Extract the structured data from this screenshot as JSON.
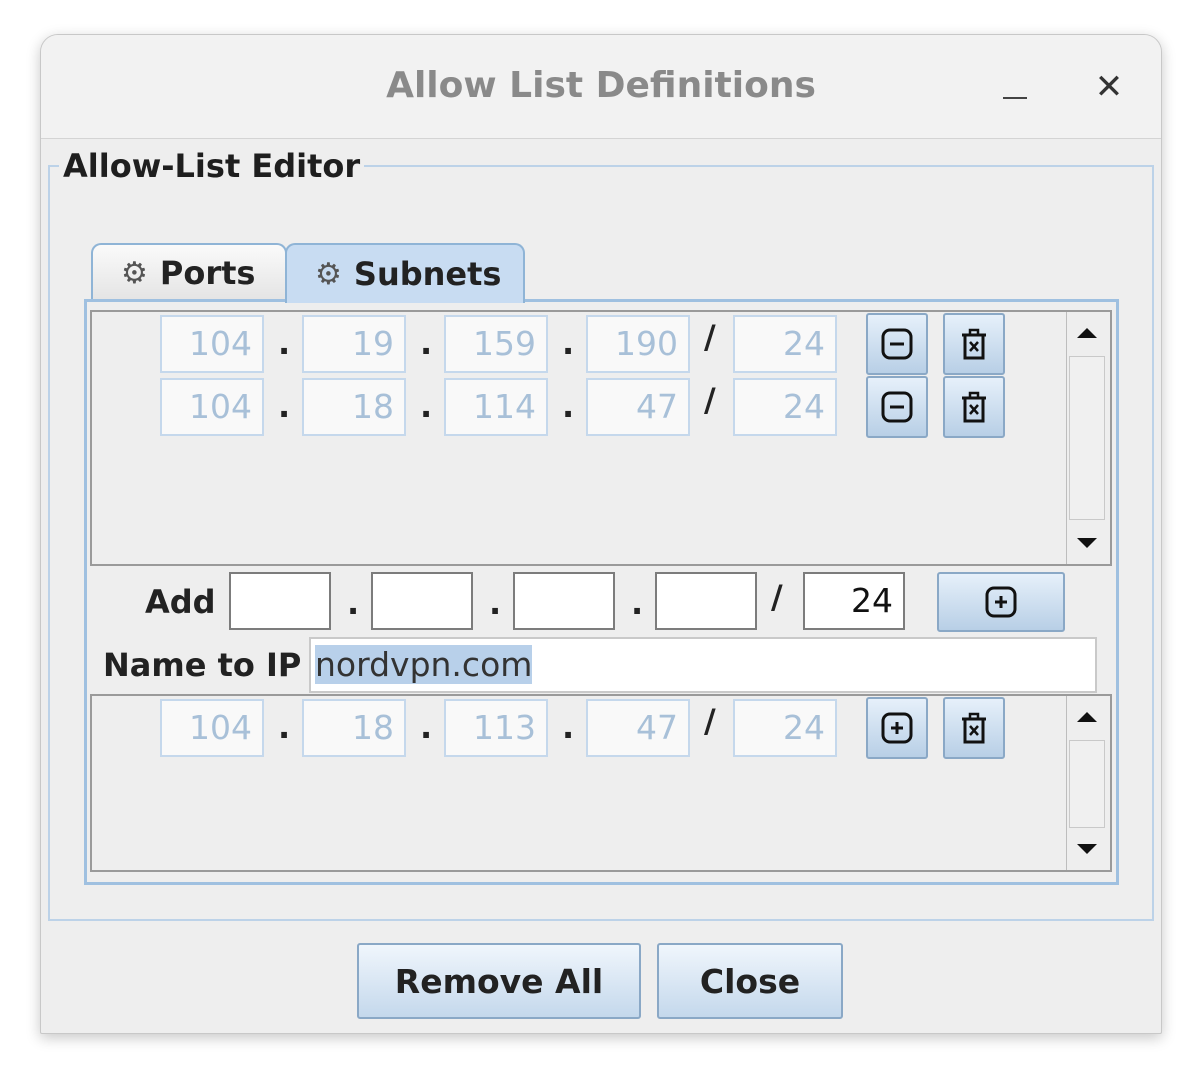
{
  "window": {
    "title": "Allow List Definitions",
    "minimize_glyph": "–",
    "close_glyph": "✕"
  },
  "group": {
    "title": "Allow-List Editor"
  },
  "tabs": [
    {
      "label": "Ports",
      "icon": "gear-icon",
      "selected": false
    },
    {
      "label": "Subnets",
      "icon": "gear-icon",
      "selected": true
    }
  ],
  "subnets": [
    {
      "o1": "104",
      "o2": "19",
      "o3": "159",
      "o4": "190",
      "mask": "24"
    },
    {
      "o1": "104",
      "o2": "18",
      "o3": "114",
      "o4": "47",
      "mask": "24"
    }
  ],
  "add": {
    "label": "Add",
    "o1": "",
    "o2": "",
    "o3": "",
    "o4": "",
    "mask": "24",
    "dot": ".",
    "slash": "/"
  },
  "name_to_ip": {
    "label": "Name to IP",
    "value": "nordvpn.com"
  },
  "resolved": [
    {
      "o1": "104",
      "o2": "18",
      "o3": "113",
      "o4": "47",
      "mask": "24"
    }
  ],
  "footer": {
    "remove_all_label": "Remove All",
    "close_label": "Close"
  },
  "colors": {
    "tab_selected": "#c8dcf2",
    "accent_border": "#9fc0e0",
    "disabled_text": "#a8c0d8"
  }
}
